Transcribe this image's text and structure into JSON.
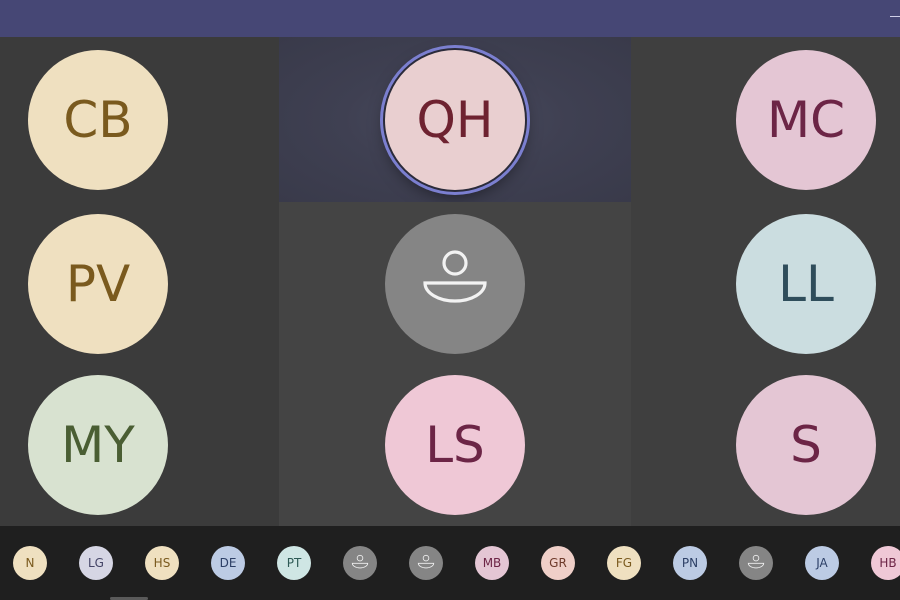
{
  "grid": {
    "tiles": [
      {
        "initials": "CB",
        "bg": "#efe0c0",
        "fg": "#7a5a1e"
      },
      {
        "initials": "QH",
        "bg": "#e9cfd0",
        "fg": "#6e2230",
        "speaking": true
      },
      {
        "initials": "MC",
        "bg": "#e4c6d4",
        "fg": "#6c2546"
      },
      {
        "initials": "PV",
        "bg": "#efe0c0",
        "fg": "#7a5a1e"
      },
      {
        "initials": "",
        "bg": "#858585",
        "fg": "#f2f2f2",
        "icon": "person-icon"
      },
      {
        "initials": "LL",
        "bg": "#cbdde0",
        "fg": "#2f4d5b"
      },
      {
        "initials": "MY",
        "bg": "#d8e2d0",
        "fg": "#4a5e33"
      },
      {
        "initials": "LS",
        "bg": "#efc8d6",
        "fg": "#6c2546"
      },
      {
        "initials": "S",
        "bg": "#e4c6d4",
        "fg": "#6c2546"
      }
    ]
  },
  "strip": {
    "participants": [
      {
        "initials": "N",
        "bg": "#efe0c0",
        "fg": "#7a5a1e"
      },
      {
        "initials": "LG",
        "bg": "#d6d6e4",
        "fg": "#444466"
      },
      {
        "initials": "HS",
        "bg": "#efe0c0",
        "fg": "#7a5a1e"
      },
      {
        "initials": "DE",
        "bg": "#bccbe4",
        "fg": "#2c3f66"
      },
      {
        "initials": "PT",
        "bg": "#cfe6e4",
        "fg": "#2e5a55"
      },
      {
        "initials": "",
        "bg": "#858585",
        "fg": "#f2f2f2",
        "icon": "person-icon"
      },
      {
        "initials": "",
        "bg": "#858585",
        "fg": "#f2f2f2",
        "icon": "person-icon"
      },
      {
        "initials": "MB",
        "bg": "#e4c6d4",
        "fg": "#6c2546"
      },
      {
        "initials": "GR",
        "bg": "#efcfc8",
        "fg": "#6e3a2a"
      },
      {
        "initials": "FG",
        "bg": "#efe0c0",
        "fg": "#7a5a1e"
      },
      {
        "initials": "PN",
        "bg": "#bccbe4",
        "fg": "#2c3f66"
      },
      {
        "initials": "",
        "bg": "#858585",
        "fg": "#f2f2f2",
        "icon": "person-icon"
      },
      {
        "initials": "JA",
        "bg": "#bccbe4",
        "fg": "#2c3f66"
      },
      {
        "initials": "HB",
        "bg": "#efc8d6",
        "fg": "#6c2546"
      }
    ]
  },
  "colors": {
    "topbar": "#464775",
    "grid_background": "#3d3d3d",
    "strip_background": "#1f1f1f",
    "speaking_ring": "#7b7fd0"
  }
}
